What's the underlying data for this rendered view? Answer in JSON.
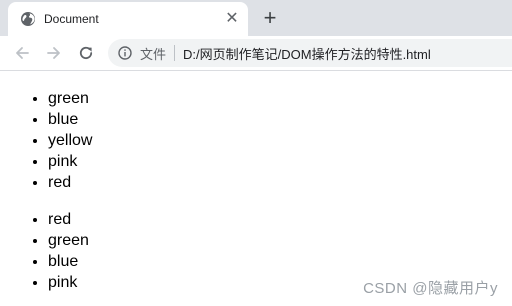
{
  "browser": {
    "tab": {
      "title": "Document",
      "close_glyph": "✕",
      "icon": "globe-icon"
    },
    "new_tab_glyph": "+",
    "nav": {
      "back_icon": "back-arrow-icon",
      "forward_icon": "forward-arrow-icon",
      "reload_icon": "reload-icon"
    },
    "address_bar": {
      "info_icon": "info-icon",
      "scheme_label": "文件",
      "url": "D:/网页制作笔记/DOM操作方法的特性.html"
    }
  },
  "page": {
    "list1": [
      "green",
      "blue",
      "yellow",
      "pink",
      "red"
    ],
    "list2": [
      "red",
      "green",
      "blue",
      "pink"
    ]
  },
  "watermark": "CSDN @隐藏用户y"
}
